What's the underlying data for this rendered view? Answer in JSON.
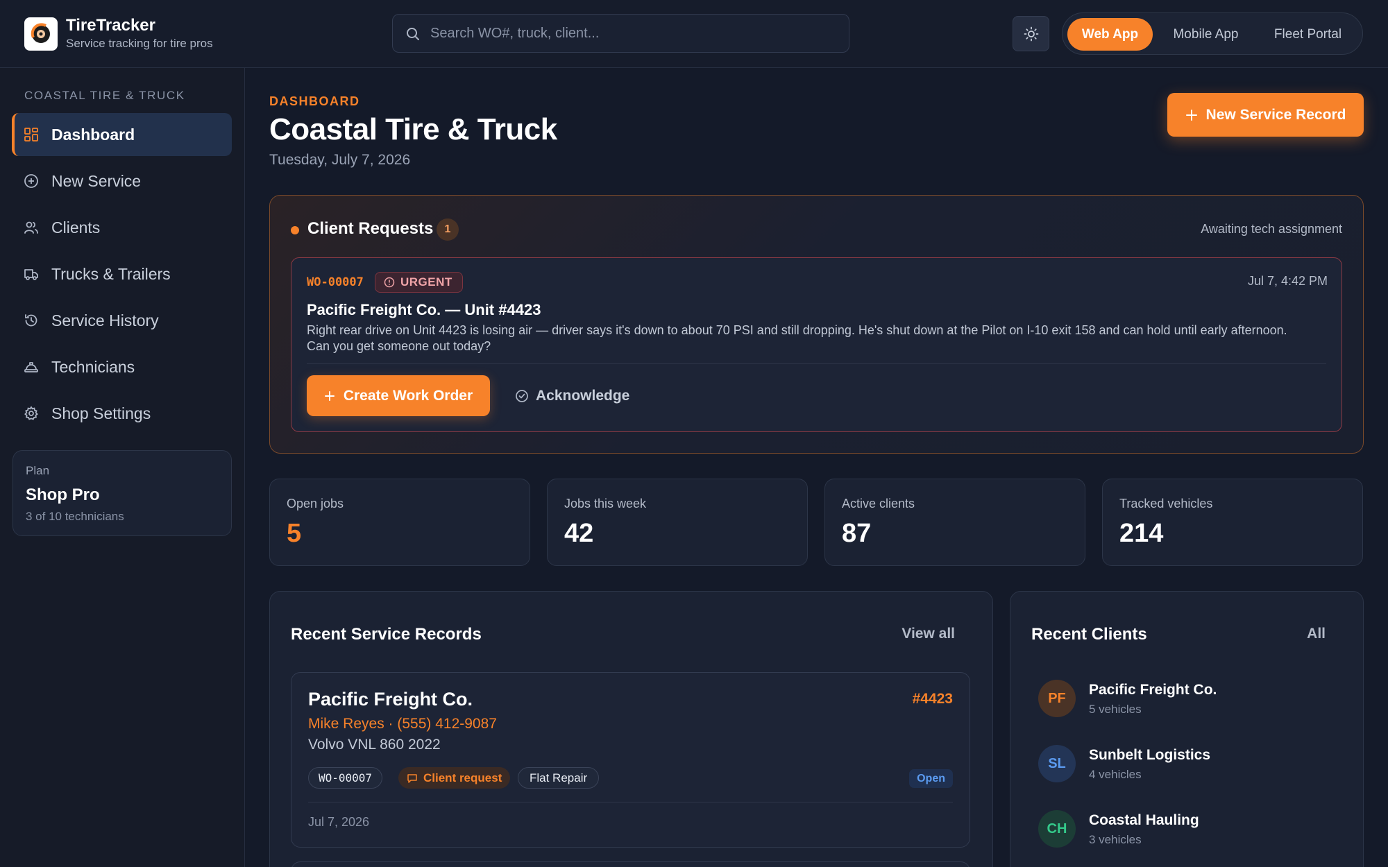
{
  "app": {
    "name": "TireTracker",
    "tagline": "Service tracking for tire pros"
  },
  "search": {
    "placeholder": "Search WO#, truck, client..."
  },
  "app_switch": {
    "options": [
      "Web App",
      "Mobile App",
      "Fleet Portal"
    ],
    "selected": "Web App"
  },
  "sidebar": {
    "org_label": "COASTAL TIRE & TRUCK",
    "items": [
      {
        "label": "Dashboard",
        "icon": "grid-icon",
        "active": true
      },
      {
        "label": "New Service",
        "icon": "plus-circle-icon"
      },
      {
        "label": "Clients",
        "icon": "users-icon"
      },
      {
        "label": "Trucks & Trailers",
        "icon": "truck-icon"
      },
      {
        "label": "Service History",
        "icon": "history-icon"
      },
      {
        "label": "Technicians",
        "icon": "hard-hat-icon"
      },
      {
        "label": "Shop Settings",
        "icon": "gear-icon"
      }
    ],
    "plan": {
      "label": "Plan",
      "name": "Shop Pro",
      "detail": "3 of 10 technicians"
    }
  },
  "header": {
    "eyebrow": "DASHBOARD",
    "title": "Coastal Tire & Truck",
    "date": "Tuesday, July 7, 2026",
    "new_record_label": "New Service Record"
  },
  "client_requests": {
    "title": "Client Requests",
    "count": "1",
    "status": "Awaiting tech assignment",
    "request": {
      "wo": "WO-00007",
      "badge": "URGENT",
      "time": "Jul 7, 4:42 PM",
      "heading": "Pacific Freight Co. — Unit #4423",
      "body": "Right rear drive on Unit 4423 is losing air — driver says it's down to about 70 PSI and still dropping. He's shut down at the Pilot on I-10 exit 158 and can hold until early afternoon. Can you get someone out today?",
      "create_label": "Create Work Order",
      "ack_label": "Acknowledge"
    }
  },
  "stats": [
    {
      "label": "Open jobs",
      "value": "5",
      "accent": true
    },
    {
      "label": "Jobs this week",
      "value": "42"
    },
    {
      "label": "Active clients",
      "value": "87"
    },
    {
      "label": "Tracked vehicles",
      "value": "214"
    }
  ],
  "recent_records": {
    "title": "Recent Service Records",
    "link": "View all",
    "items": [
      {
        "client": "Pacific Freight Co.",
        "unit": "#4423",
        "contact": "Mike Reyes · (555) 412-9087",
        "vehicle": "Volvo VNL 860 2022",
        "wo": "WO-00007",
        "source": "Client request",
        "service": "Flat Repair",
        "status": "Open",
        "date": "Jul 7, 2026"
      }
    ]
  },
  "recent_clients": {
    "title": "Recent Clients",
    "link": "All",
    "items": [
      {
        "initials": "PF",
        "name": "Pacific Freight Co.",
        "vehicles": "5 vehicles",
        "color": "#f7822a",
        "bg": "#4a3326"
      },
      {
        "initials": "SL",
        "name": "Sunbelt Logistics",
        "vehicles": "4 vehicles",
        "color": "#5b9bf0",
        "bg": "#233556"
      },
      {
        "initials": "CH",
        "name": "Coastal Hauling",
        "vehicles": "3 vehicles",
        "color": "#34c98a",
        "bg": "#1c3d36"
      }
    ]
  },
  "colors": {
    "accent": "#f7822a",
    "background": "#141a29",
    "urgent": "#f0a4a8",
    "open_status": "#5b9bf0"
  }
}
